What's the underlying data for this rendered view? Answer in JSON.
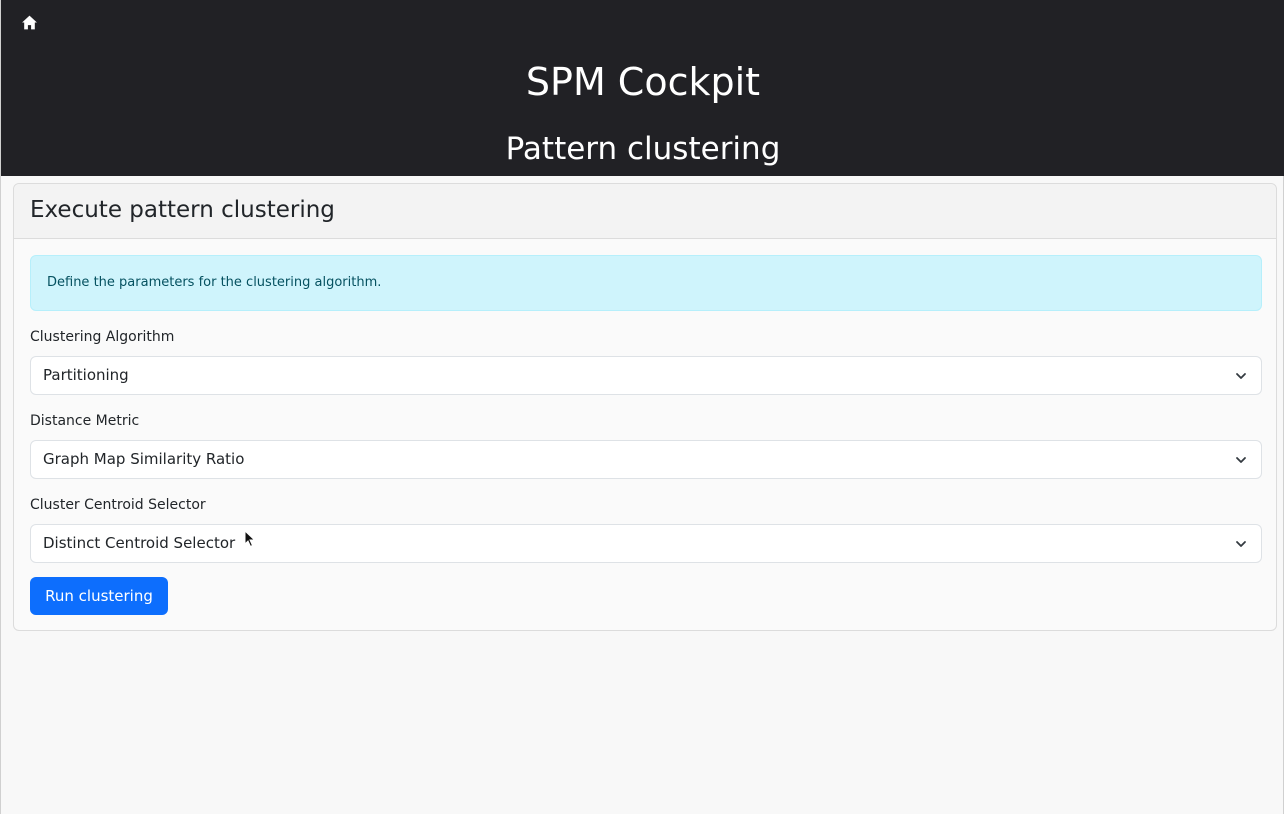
{
  "header": {
    "home_icon": "home-icon",
    "app_title": "SPM Cockpit",
    "page_subtitle": "Pattern clustering"
  },
  "card": {
    "title": "Execute pattern clustering",
    "info_text": "Define the parameters for the clustering algorithm.",
    "fields": [
      {
        "label": "Clustering Algorithm",
        "value": "Partitioning"
      },
      {
        "label": "Distance Metric",
        "value": "Graph Map Similarity Ratio"
      },
      {
        "label": "Cluster Centroid Selector",
        "value": "Distinct Centroid Selector"
      }
    ],
    "run_button_label": "Run clustering"
  },
  "colors": {
    "header_bg": "#212125",
    "primary": "#0d6efd",
    "info_bg": "#cff4fc",
    "info_text": "#055160"
  }
}
